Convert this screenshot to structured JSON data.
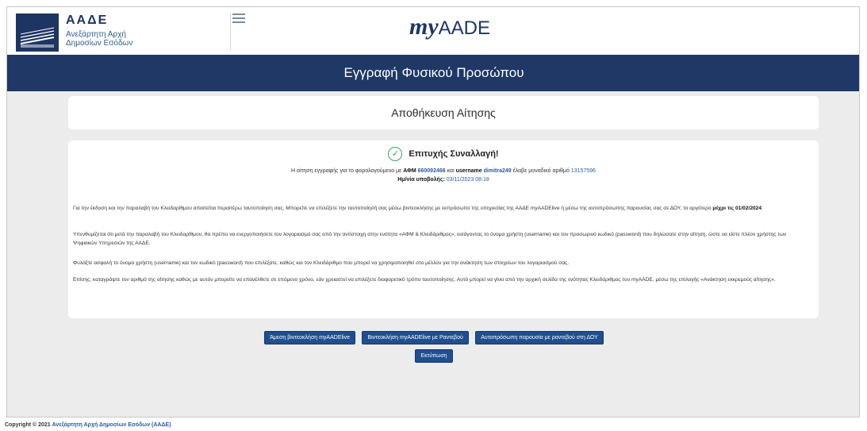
{
  "header": {
    "org_name": "ΑΑΔΕ",
    "org_sub_line1": "Ανεξάρτητη Αρχή",
    "org_sub_line2": "Δημοσίων Εσόδων",
    "brand_my": "my",
    "brand_aade": "AADE",
    "logo_icon": "aade-logo-icon",
    "menu_icon": "hamburger-menu-icon"
  },
  "page_title": "Εγγραφή Φυσικού Προσώπου",
  "section_title": "Αποθήκευση Αίτησης",
  "result": {
    "status_icon": "check-circle-icon",
    "title": "Επιτυχής Συναλλαγή!",
    "summary_prefix": "Η αίτηση εγγραφής για το φορολογούμενο με",
    "afm_label": "ΑΦΜ",
    "afm_value": "660092466",
    "and_text": "και",
    "username_label": "username",
    "username_value": "dimitra249",
    "received_text": "έλαβε μοναδικό αριθμό",
    "application_number": "13157596",
    "submission_label": "Ημ/νία υποβολής:",
    "submission_date": "03/11/2023 08:18"
  },
  "paragraphs": {
    "p1_text": "Για την έκδοση και την παραλαβή του Κλειδαρίθμου απαιτείται περαιτέρω ταυτοποίηση σας. Μπορείτε να επιλέξετε την ταυτοποίησή σας μέσω βιντεοκλήσης με εκπρόσωπο της υπηρεσίας της ΑΑΔΕ myAADElive ή μέσω της αυτοπρόσωπης παρουσίας σας σε ΔΟΥ, το αργότερο",
    "p1_bold": "μέχρι τις 01/02/2024",
    "p2": "Υπενθυμίζεται ότι μετά την παραλαβή του Κλειδαρίθμου, θα πρέπει να ενεργοποιήσετε τον λογαριασμό σας από την αντίστοιχη στην ενότητα «ΑΦΜ & Κλειδάριθμος», εισάγοντας το όνομα χρήστη (username) και τον προσωρινό κωδικό (password) που δηλώσατε στην αίτηση, ώστε να είστε πλέον χρήστης των Ψηφιακών Υπηρεσιών της ΑΑΔΕ.",
    "p3": "Φυλάξτε ασφαλή το όνομα χρήστη (username) και τον κωδικό (password) που επιλέξατε, καθώς και τον Κλειδάριθμο που μπορεί να χρησιμοποιηθεί στο μέλλον για την ανάκτηση των στοιχείων του λογαριασμού σας.",
    "p4": "Επίσης, καταγράψτε τον αριθμό της αίτησης καθώς με αυτόν μπορείτε να επανέλθετε σε επόμενο χρόνο, εάν χρειαστεί να επιλέξετε διαφορετικό τρόπο ταυτοποίησης. Αυτό μπορεί να γίνει από την αρχική σελίδα της ενότητας Κλειδάριθμος του myAADE, μέσω της επιλογής «Ανάκτηση εκκρεμούς αίτησης»."
  },
  "actions": {
    "btn_video_now": "Άμεση βιντεοκλήση myAADElive",
    "btn_video_appointment": "Βιντεοκλήση myAADElive με Ραντεβού",
    "btn_in_person": "Αυτοπρόσωπη παρουσία με ραντεβού στη ΔΟΥ",
    "btn_print": "Εκτύπωση"
  },
  "footer": {
    "copyright": "Copyright © 2021",
    "org_link": "Ανεξάρτητη Αρχή Δημοσίων Εσόδων (ΑΑΔΕ)"
  }
}
